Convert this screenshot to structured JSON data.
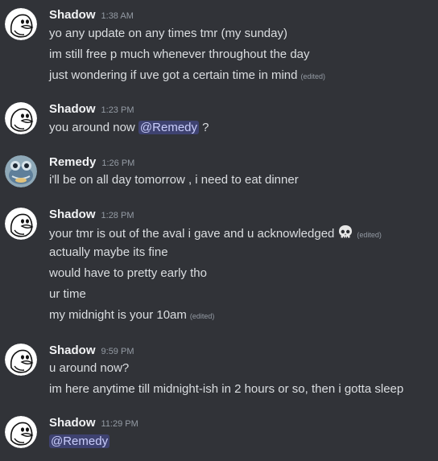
{
  "colors": {
    "background": "#313338",
    "username": "#f2f3f5",
    "text": "#dbdee1",
    "muted": "#949ba4",
    "mention_bg": "#3e4270",
    "mention_text": "#c9cdfb"
  },
  "messages": [
    {
      "author": "Shadow",
      "time": "1:38 AM",
      "lines": [
        {
          "text": "yo any update on any times tmr (my sunday)"
        },
        {
          "text": "im still free p much whenever throughout the day"
        },
        {
          "text": "just wondering if uve got a certain time in mind",
          "edited": "(edited)"
        }
      ]
    },
    {
      "author": "Shadow",
      "time": "1:23 PM",
      "lines": [
        {
          "text": "you around now ",
          "mention": "@Remedy",
          "after": " ?"
        }
      ]
    },
    {
      "author": "Remedy",
      "time": "1:26 PM",
      "lines": [
        {
          "text": "i'll be on all day tomorrow , i need to eat dinner"
        }
      ]
    },
    {
      "author": "Shadow",
      "time": "1:28 PM",
      "lines": [
        {
          "text": "your tmr is out of the aval i gave and u acknowledged",
          "emoji": "skull-emoji",
          "edited": "(edited)"
        },
        {
          "text": "actually maybe its fine"
        },
        {
          "text": "would have to pretty early tho"
        },
        {
          "text": "ur time"
        },
        {
          "text": "my midnight is your 10am",
          "edited": "(edited)"
        }
      ]
    },
    {
      "author": "Shadow",
      "time": "9:59 PM",
      "lines": [
        {
          "text": "u around now?"
        },
        {
          "text": "im here anytime till midnight-ish in 2 hours or so, then i gotta sleep"
        }
      ]
    },
    {
      "author": "Shadow",
      "time": "11:29 PM",
      "lines": [
        {
          "mention": "@Remedy"
        }
      ]
    }
  ]
}
